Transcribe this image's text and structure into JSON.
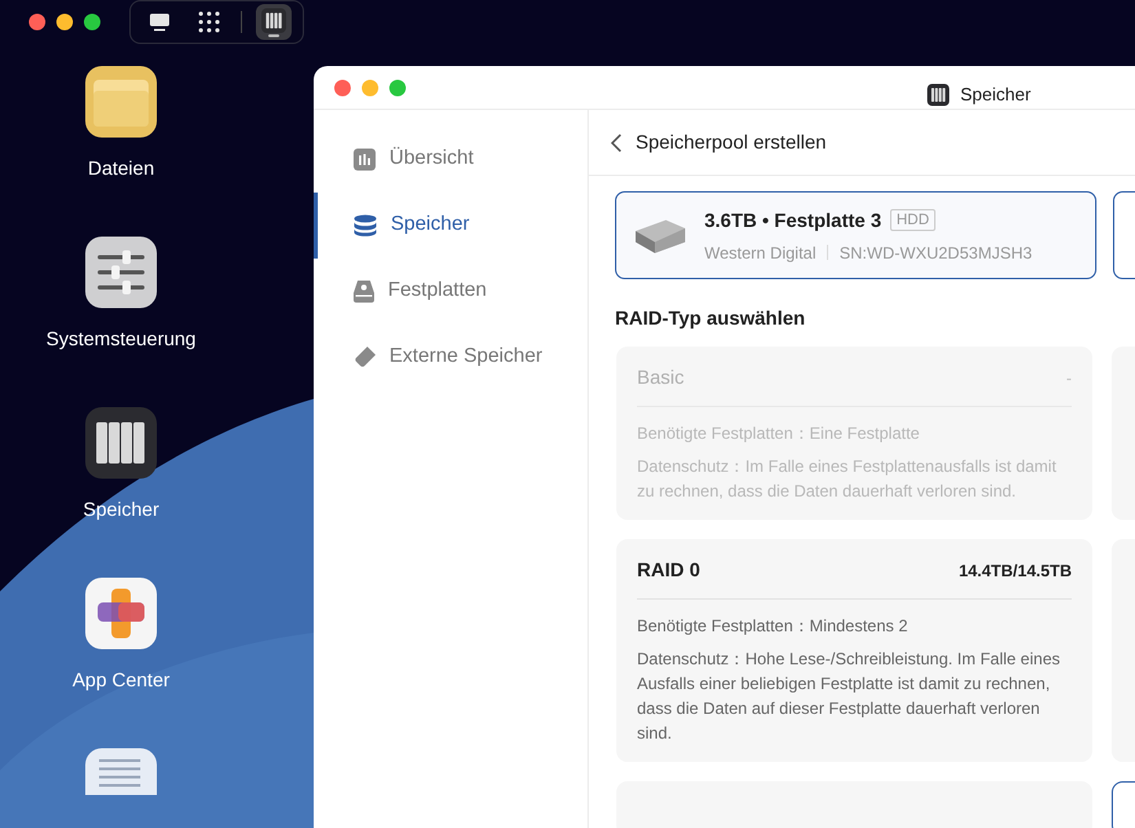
{
  "desktop": {
    "toolbar": [
      {
        "kind": "desktop",
        "selected": false
      },
      {
        "kind": "apps",
        "selected": false
      },
      {
        "kind": "storage",
        "selected": true
      }
    ],
    "apps": [
      {
        "label": "Dateien",
        "kind": "folder"
      },
      {
        "label": "Systemsteuerung",
        "kind": "settings"
      },
      {
        "label": "Speicher",
        "kind": "storage"
      },
      {
        "label": "App Center",
        "kind": "appcenter"
      },
      {
        "kind": "logs"
      }
    ]
  },
  "window": {
    "title": "Speicher",
    "sidebar": {
      "items": [
        {
          "label": "Übersicht",
          "kind": "overview",
          "selected": false
        },
        {
          "label": "Speicher",
          "kind": "storage",
          "selected": true
        },
        {
          "label": "Festplatten",
          "kind": "disks",
          "selected": false
        },
        {
          "label": "Externe Speicher",
          "kind": "external",
          "selected": false
        }
      ]
    },
    "header": {
      "title": "Speicherpool erstellen"
    },
    "disks": [
      {
        "title": "3.6TB • Festplatte 3",
        "badge": "HDD",
        "vendor": "Western Digital",
        "serial": "SN:WD-WXU2D53MJSH3",
        "selected": true
      }
    ],
    "raid_section": {
      "title": "RAID-Typ auswählen",
      "options": [
        {
          "name": "Basic",
          "capacity": "-",
          "disabled": true,
          "requirement": "Benötigte Festplatten：Eine Festplatte",
          "protection": "Datenschutz：Im Falle eines Festplattenausfalls ist damit zu rechnen, dass die Daten dauerhaft verloren sind."
        },
        {
          "name": "RAID 0",
          "capacity": "14.4TB/14.5TB",
          "disabled": false,
          "requirement": "Benötigte Festplatten：Mindestens 2",
          "protection": "Datenschutz：Hohe Lese-/Schreibleistung. Im Falle eines Ausfalls einer beliebigen Festplatte ist damit zu rechnen, dass die Daten auf dieser Festplatte dauerhaft verloren sind."
        }
      ]
    }
  }
}
